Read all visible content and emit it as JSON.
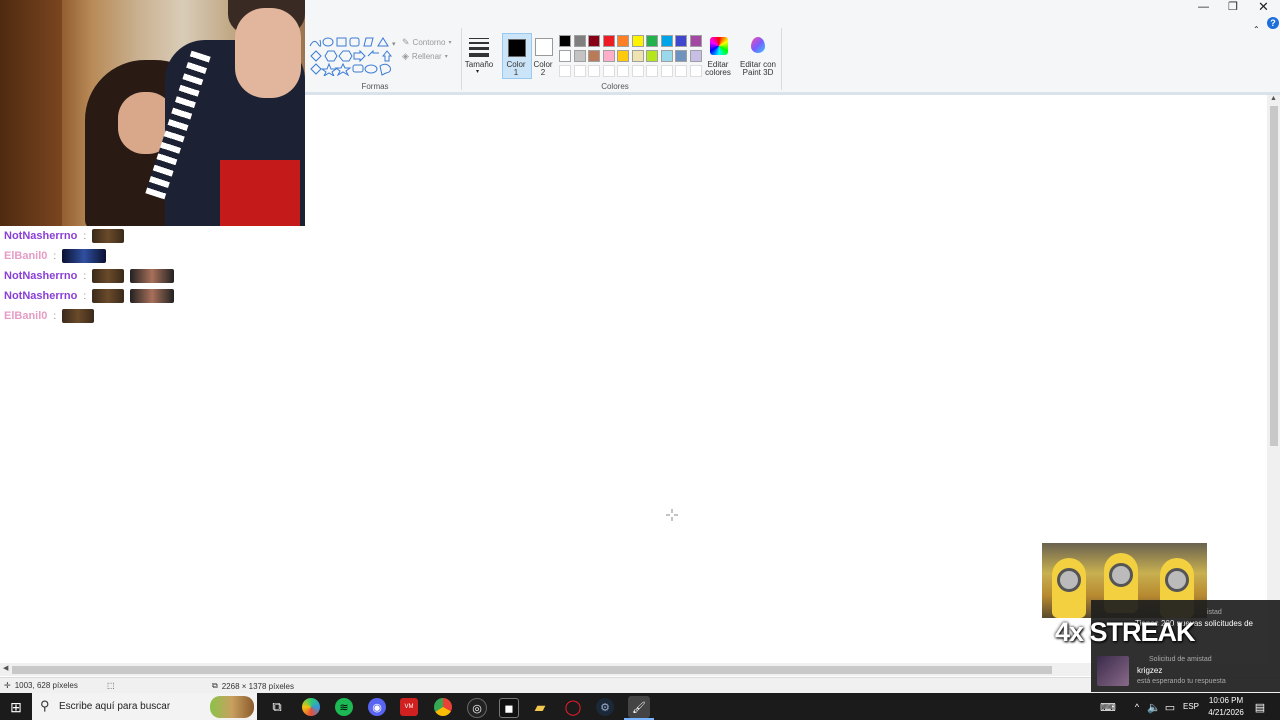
{
  "window": {
    "title": "Paint"
  },
  "ribbon": {
    "shapes_group": "Formas",
    "outline": "Contorno",
    "fill": "Rellenar",
    "size": "Tamaño",
    "color1_line1": "Color",
    "color1_line2": "1",
    "color2_line1": "Color",
    "color2_line2": "2",
    "colors_group": "Colores",
    "edit_colors_line1": "Editar",
    "edit_colors_line2": "colores",
    "edit_paint3d_line1": "Editar con",
    "edit_paint3d_line2": "Paint 3D",
    "palette_row1": [
      "#000000",
      "#7f7f7f",
      "#880015",
      "#ed1c24",
      "#ff7f27",
      "#fff200",
      "#22b14c",
      "#00a2e8",
      "#3f48cc",
      "#a349a4"
    ],
    "palette_row2": [
      "#ffffff",
      "#c3c3c3",
      "#b97a57",
      "#ffaec9",
      "#ffc90e",
      "#efe4b0",
      "#b5e61d",
      "#99d9ea",
      "#7092be",
      "#c8bfe7"
    ]
  },
  "chat": {
    "messages": [
      {
        "user": "NotNasherrno",
        "color": "#8a3fd8",
        "sep": ":",
        "emotes": [
          "grp"
        ]
      },
      {
        "user": "ElBanil0",
        "color": "#e59cc6",
        "sep": ":",
        "emotes": [
          "dark"
        ]
      },
      {
        "user": "NotNasherrno",
        "color": "#8a3fd8",
        "sep": ":",
        "emotes": [
          "grp",
          "face"
        ]
      },
      {
        "user": "NotNasherrno",
        "color": "#8a3fd8",
        "sep": ":",
        "emotes": [
          "grp",
          "face"
        ]
      },
      {
        "user": "ElBanil0",
        "color": "#e59cc6",
        "sep": ":",
        "emotes": [
          "grp"
        ]
      }
    ]
  },
  "statusbar": {
    "cursor_pos": "1003, 628 píxeles",
    "image_size": "2268 × 1378 píxeles"
  },
  "overlay": {
    "streak": "4x STREAK",
    "notif_header": "istad",
    "notif_title": "Tienes 200 nuevas solicitudes de",
    "notif_type": "Solicitud de amistad",
    "notif_user": "krigzez",
    "notif_sub": "está esperando tu respuesta"
  },
  "taskbar": {
    "search_placeholder": "Escribe aquí para buscar",
    "lang": "ESP",
    "time": "10:06 PM",
    "date": "4/21/2026"
  }
}
